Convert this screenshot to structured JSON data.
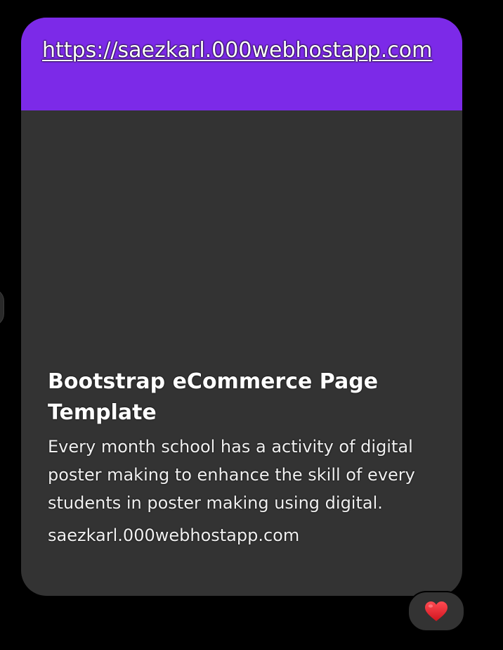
{
  "message": {
    "link": {
      "url_text": "https://saezkarl.000webhostapp.com"
    },
    "preview": {
      "title": "Bootstrap eCommerce Page Template",
      "description": "Every month school has a activity of digital poster making to enhance the skill of every students in poster making using digital.",
      "domain": "saezkarl.000webhostapp.com"
    },
    "reaction": {
      "icon": "heart-icon",
      "color": "#e8202a"
    }
  },
  "colors": {
    "background": "#000000",
    "bubble": "#333333",
    "link_header": "#7c2ae8",
    "text": "#ffffff"
  }
}
